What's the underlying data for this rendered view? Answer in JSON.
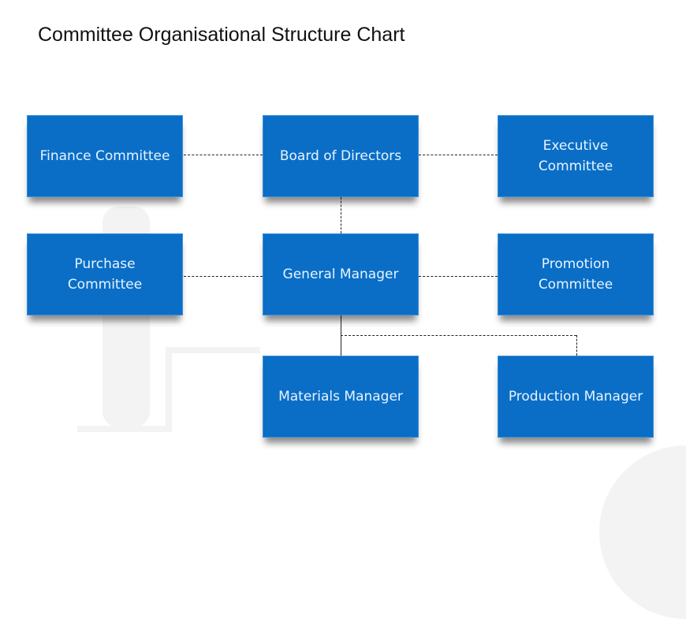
{
  "title": "Committee Organisational Structure Chart",
  "colors": {
    "box": "#0a6ec7",
    "box_text": "#e8f4ff",
    "connector": "#222222"
  },
  "nodes": {
    "finance": "Finance Committee",
    "board": "Board of Directors",
    "executive": "Executive Committee",
    "purchase": "Purchase Committee",
    "general_manager": "General Manager",
    "promotion": "Promotion Committee",
    "materials": "Materials Manager",
    "production": "Production Manager"
  },
  "edges": [
    {
      "from": "board",
      "to": "finance",
      "style": "dashed"
    },
    {
      "from": "board",
      "to": "executive",
      "style": "dashed"
    },
    {
      "from": "board",
      "to": "general_manager",
      "style": "dashed"
    },
    {
      "from": "general_manager",
      "to": "purchase",
      "style": "dashed"
    },
    {
      "from": "general_manager",
      "to": "promotion",
      "style": "dashed"
    },
    {
      "from": "general_manager",
      "to": "materials",
      "style": "solid"
    },
    {
      "from": "general_manager",
      "to": "production",
      "style": "dashed"
    }
  ]
}
